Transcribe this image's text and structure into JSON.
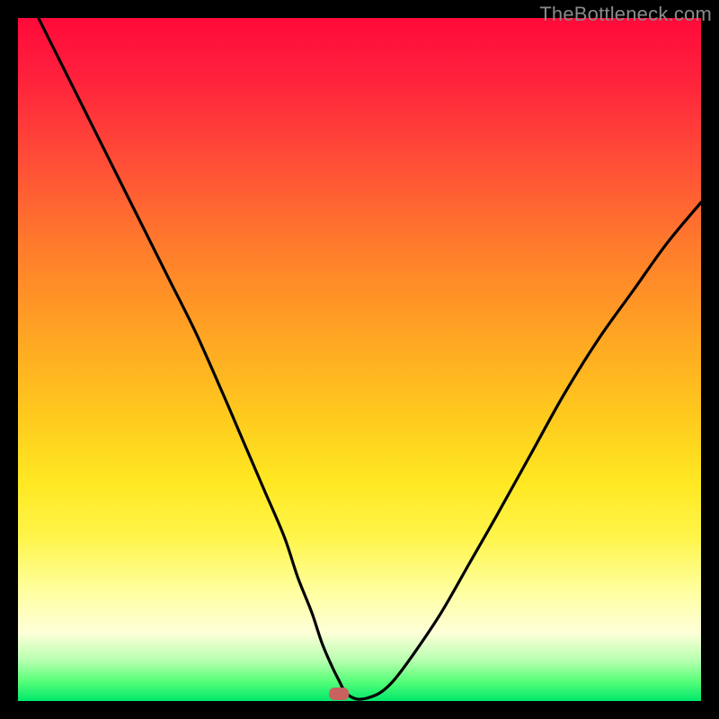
{
  "watermark": {
    "text": "TheBottleneck.com"
  },
  "marker": {
    "color": "#c9625e",
    "x_pct": 47,
    "y_pct": 0
  },
  "colors": {
    "gradient_top": "#ff0a3a",
    "gradient_bottom": "#00e86a",
    "curve": "#000000",
    "background": "#000000"
  },
  "chart_data": {
    "type": "line",
    "title": "",
    "xlabel": "",
    "ylabel": "",
    "xlim": [
      0,
      100
    ],
    "ylim": [
      0,
      100
    ],
    "grid": false,
    "legend": false,
    "series": [
      {
        "name": "bottleneck-curve",
        "x": [
          3,
          6,
          10,
          14,
          18,
          22,
          26,
          30,
          33,
          36,
          39,
          41,
          43,
          44.5,
          46,
          47,
          48,
          49.5,
          51,
          53,
          55,
          58,
          62,
          66,
          70,
          75,
          80,
          85,
          90,
          95,
          100
        ],
        "y": [
          100,
          94,
          86,
          78,
          70,
          62,
          54,
          45,
          38,
          31,
          24,
          18,
          13,
          8.5,
          5,
          3,
          1.2,
          0.3,
          0.4,
          1.2,
          3,
          7,
          13,
          20,
          27,
          36,
          45,
          53,
          60,
          67,
          73
        ]
      }
    ],
    "annotations": [
      {
        "name": "optimal-marker",
        "x": 47,
        "y": 0.2,
        "shape": "rounded-rect",
        "color": "#c9625e"
      }
    ]
  }
}
